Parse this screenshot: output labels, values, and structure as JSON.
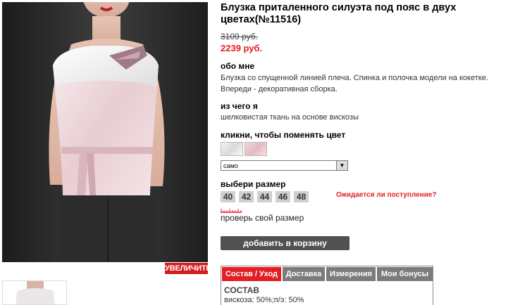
{
  "product": {
    "title": "Блузка приталенного силуэта под пояс в двух цветах(№11516)",
    "old_price": "3109 руб.",
    "new_price": "2239 руб.",
    "zoom_label": "УВЕЛИЧИТЬ"
  },
  "about": {
    "heading": "обо мне",
    "text": "Блузка со спущенной линией плеча. Спинка и полочка модели на кокетке. Впереди - декоративная сборка."
  },
  "material": {
    "heading": "из чего я",
    "text": "шелковистая ткань на основе вискозы"
  },
  "color": {
    "heading": "кликни, чтобы поменять цвет",
    "selected": "само",
    "swatches": [
      "#e6e6e6",
      "#ecc8cd"
    ]
  },
  "size": {
    "heading": "выбери размер",
    "options": [
      "40",
      "42",
      "44",
      "46",
      "48"
    ],
    "awaiting_link": "Ожидается ли поступление?",
    "check_link": "проверь свой размер"
  },
  "cart": {
    "button_label": "добавить в корзину"
  },
  "tabs": {
    "items": [
      "Состав / Уход",
      "Доставка",
      "Измерения",
      "Мои бонусы"
    ],
    "active": 0
  },
  "composition": {
    "heading": "СОСТАВ",
    "text": "вискоза: 50%;п/э: 50%"
  },
  "colors": {
    "accent": "#e31e24",
    "button": "#515151",
    "tab_inactive": "#7b7b7b"
  }
}
